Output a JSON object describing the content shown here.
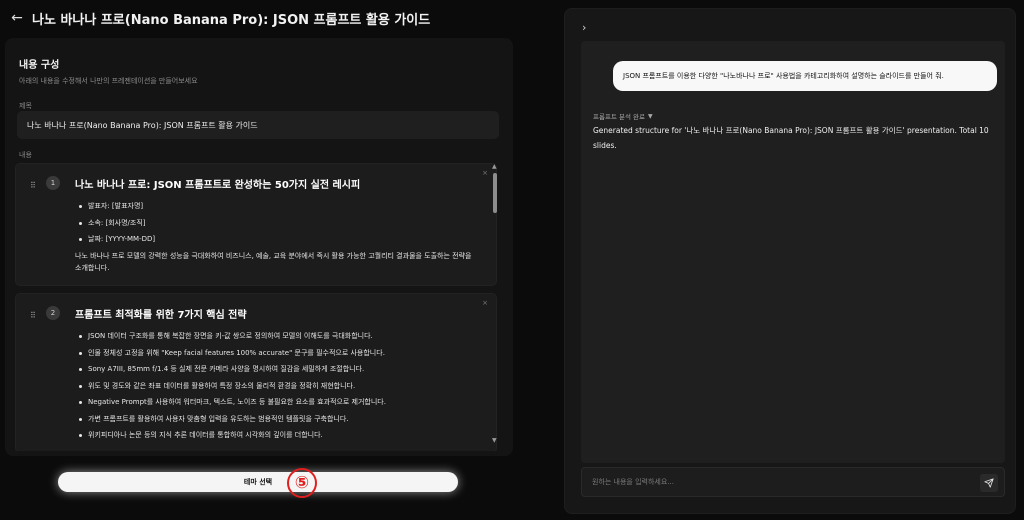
{
  "header": {
    "back_icon": "arrow-left-icon",
    "title": "나노 바나나 프로(Nano Banana Pro): JSON 프롬프트 활용 가이드"
  },
  "editor": {
    "section_title": "내용 구성",
    "section_subtitle": "아래의 내용을 수정해서 나만의 프레젠테이션을 만들어보세요",
    "title_label": "제목",
    "title_value": "나노 바나나 프로(Nano Banana Pro): JSON 프롬프트 활용 가이드",
    "content_label": "내용",
    "slides": [
      {
        "number": "1",
        "title": "나노 바나나 프로: JSON 프롬프트로 완성하는 50가지 실전 레시피",
        "bullets": [
          "발표자: [발표자명]",
          "소속: [회사명/조직]",
          "날짜: [YYYY-MM-DD]"
        ],
        "description": "나노 바나나 프로 모델의 강력한 성능을 극대화하여 비즈니스, 예술, 교육 분야에서 즉시 활용 가능한 고퀄리티 결과물을 도출하는 전략을 소개합니다."
      },
      {
        "number": "2",
        "title": "프롬프트 최적화를 위한 7가지 핵심 전략",
        "bullets": [
          "JSON 데이터 구조화를 통해 복잡한 장면을 키-값 쌍으로 정의하여 모델의 이해도를 극대화합니다.",
          "인물 정체성 고정을 위해 \"Keep facial features 100% accurate\" 문구를 필수적으로 사용합니다.",
          "Sony A7III, 85mm f/1.4 등 실제 전문 카메라 사양을 명시하여 질감을 세밀하게 조절합니다.",
          "위도 및 경도와 같은 좌표 데이터를 활용하여 특정 장소의 물리적 환경을 정확히 재현합니다.",
          "Negative Prompt를 사용하여 워터마크, 텍스트, 노이즈 등 불필요한 요소를 효과적으로 제거합니다.",
          "가변 프롬프트를 활용하여 사용자 맞춤형 입력을 유도하는 범용적인 템플릿을 구축합니다.",
          "위키피디아나 논문 등의 지식 추론 데이터를 통합하여 시각화의 깊이를 더합니다."
        ]
      }
    ],
    "theme_button_label": "테마 선택",
    "step_marker": "5"
  },
  "chat": {
    "user_message": "JSON 프롬프트를 이용한 다양한 \"나노바나나 프로\" 사용법을 카테고리화하여 설명하는 슬라이드를 만들어 줘.",
    "analysis_status": "프롬프트 분석 완료",
    "result_message": "Generated structure for '나노 바나나 프로(Nano Banana Pro): JSON 프롬프트 활용 가이드' presentation. Total 10 slides.",
    "input_placeholder": "원하는 내용을 입력하세요...",
    "send_icon": "send-icon",
    "collapse_icon": "chevron-right-icon"
  }
}
